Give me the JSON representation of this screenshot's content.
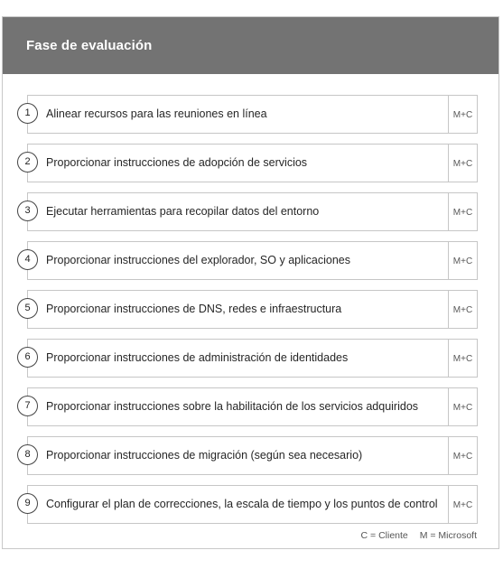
{
  "header": {
    "title": "Fase de evaluación"
  },
  "steps": [
    {
      "number": "1",
      "label": "Alinear recursos para las reuniones en línea",
      "owner": "M+C"
    },
    {
      "number": "2",
      "label": "Proporcionar instrucciones de adopción de servicios",
      "owner": "M+C"
    },
    {
      "number": "3",
      "label": "Ejecutar herramientas para recopilar datos del entorno",
      "owner": "M+C"
    },
    {
      "number": "4",
      "label": "Proporcionar instrucciones del explorador, SO y aplicaciones",
      "owner": "M+C"
    },
    {
      "number": "5",
      "label": "Proporcionar instrucciones de DNS, redes e infraestructura",
      "owner": "M+C"
    },
    {
      "number": "6",
      "label": "Proporcionar instrucciones de administración de identidades",
      "owner": "M+C"
    },
    {
      "number": "7",
      "label": "Proporcionar instrucciones sobre la habilitación de los servicios adquiridos",
      "owner": "M+C"
    },
    {
      "number": "8",
      "label": "Proporcionar instrucciones de migración (según sea necesario)",
      "owner": "M+C"
    },
    {
      "number": "9",
      "label": "Configurar el plan de correcciones, la escala de tiempo y los puntos de control",
      "owner": "M+C"
    }
  ],
  "legend": {
    "client": "C = Cliente",
    "microsoft": "M = Microsoft"
  },
  "colors": {
    "header_bg": "#737373",
    "header_text": "#ffffff",
    "border": "#c6c6c6"
  }
}
